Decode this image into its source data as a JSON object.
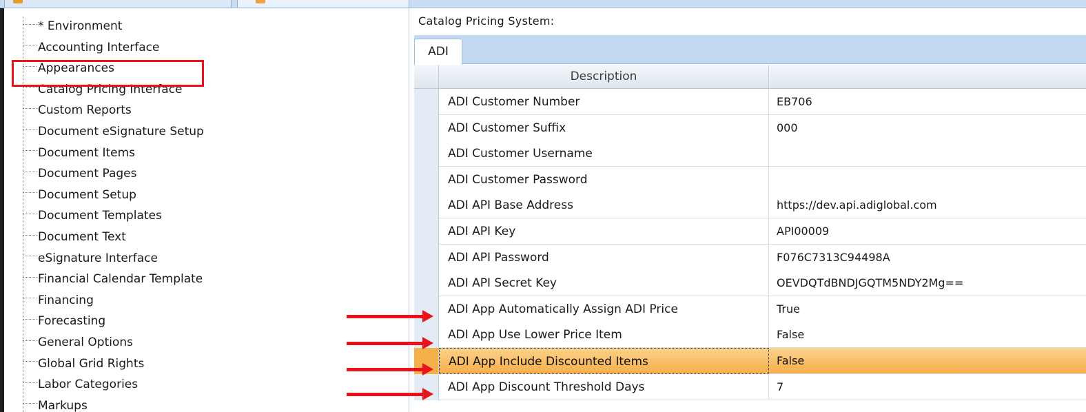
{
  "tree": {
    "items": [
      "* Environment",
      "Accounting Interface",
      "Appearances",
      "Catalog Pricing Interface",
      "Custom Reports",
      "Document eSignature Setup",
      "Document Items",
      "Document Pages",
      "Document Setup",
      "Document Templates",
      "Document Text",
      "eSignature Interface",
      "Financial Calendar Template",
      "Financing",
      "Forecasting",
      "General Options",
      "Global Grid Rights",
      "Labor Categories",
      "Markups"
    ],
    "selected": "Catalog Pricing Interface"
  },
  "panel": {
    "title": "Catalog Pricing System:",
    "tab_label": "ADI",
    "column_description": "Description",
    "column_value": ""
  },
  "rows": [
    {
      "description": "ADI Customer Number",
      "value": "EB706"
    },
    {
      "description": "ADI Customer Suffix",
      "value": "000"
    },
    {
      "description": "ADI Customer Username",
      "value": ""
    },
    {
      "description": "ADI Customer Password",
      "value": ""
    },
    {
      "description": "ADI API Base Address",
      "value": "https://dev.api.adiglobal.com"
    },
    {
      "description": "ADI API Key",
      "value": "API00009"
    },
    {
      "description": "ADI API Password",
      "value": "F076C7313C94498A"
    },
    {
      "description": "ADI API Secret Key",
      "value": "OEVDQTdBNDJGQTM5NDY2Mg=="
    },
    {
      "description": "ADI App Automatically Assign ADI Price",
      "value": "True"
    },
    {
      "description": "ADI App Use Lower Price Item",
      "value": "False"
    },
    {
      "description": "ADI App Include Discounted Items",
      "value": "False"
    },
    {
      "description": "ADI App Discount Threshold Days",
      "value": "7"
    }
  ],
  "active_row_index": 10,
  "colors": {
    "annotation_red": "#e8141c",
    "selected_row_orange": "#f7ae4a",
    "tab_band_blue": "#c3d9f1"
  }
}
